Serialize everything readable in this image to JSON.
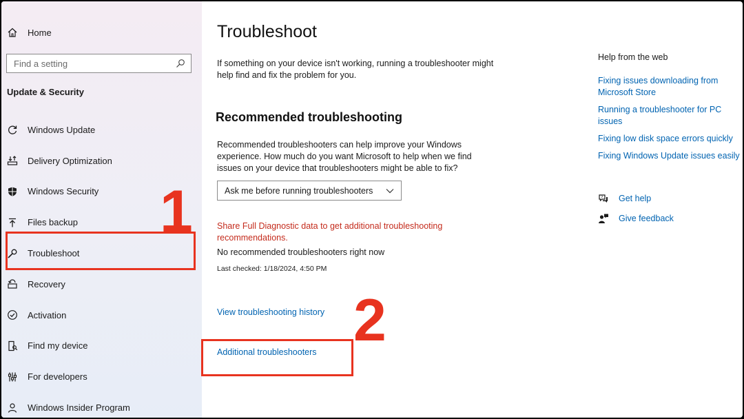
{
  "sidebar": {
    "home_label": "Home",
    "search_placeholder": "Find a setting",
    "section_title": "Update & Security",
    "items": [
      {
        "label": "Windows Update"
      },
      {
        "label": "Delivery Optimization"
      },
      {
        "label": "Windows Security"
      },
      {
        "label": "Files backup"
      },
      {
        "label": "Troubleshoot"
      },
      {
        "label": "Recovery"
      },
      {
        "label": "Activation"
      },
      {
        "label": "Find my device"
      },
      {
        "label": "For developers"
      },
      {
        "label": "Windows Insider Program"
      }
    ]
  },
  "main": {
    "title": "Troubleshoot",
    "intro": "If something on your device isn't working, running a troubleshooter might help find and fix the problem for you.",
    "recommended_title": "Recommended troubleshooting",
    "recommended_desc": "Recommended troubleshooters can help improve your Windows experience. How much do you want Microsoft to help when we find issues on your device that troubleshooters might be able to fix?",
    "dropdown_value": "Ask me before running troubleshooters",
    "diagnostic_link": "Share Full Diagnostic data to get additional troubleshooting recommendations.",
    "no_recommended": "No recommended troubleshooters right now",
    "last_checked": "Last checked: 1/18/2024, 4:50 PM",
    "history_link": "View troubleshooting history",
    "additional_link": "Additional troubleshooters"
  },
  "help": {
    "title": "Help from the web",
    "links": [
      {
        "label": "Fixing issues downloading from Microsoft Store"
      },
      {
        "label": "Running a troubleshooter for PC issues"
      },
      {
        "label": "Fixing low disk space errors quickly"
      },
      {
        "label": "Fixing Windows Update issues easily"
      }
    ],
    "get_help": "Get help",
    "give_feedback": "Give feedback"
  },
  "annotations": {
    "step1": "1",
    "step2": "2"
  },
  "colors": {
    "accent_link": "#0063b1",
    "warning_link": "#c42b1c",
    "annotation": "#e8331f"
  }
}
